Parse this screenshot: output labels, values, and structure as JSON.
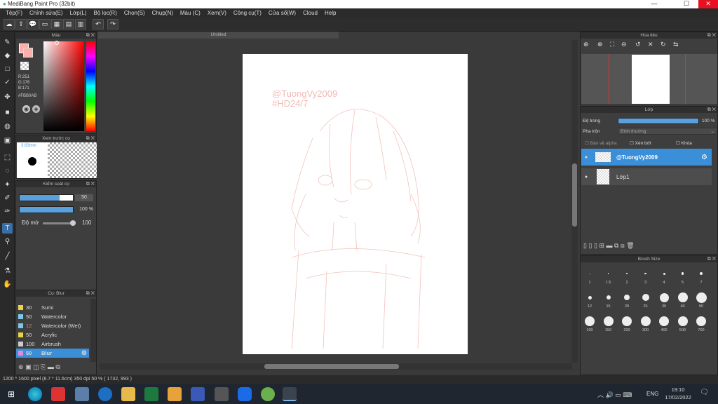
{
  "window": {
    "title": "MediBang Paint Pro (32bit)",
    "min": "—",
    "max": "☐",
    "close": "✕"
  },
  "menu": [
    "Tệp(F)",
    "Chỉnh sửa(E)",
    "Lớp(L)",
    "Bộ lọc(R)",
    "Chọn(S)",
    "Chụp(N)",
    "Màu (C)",
    "Xem(V)",
    "Công cụ(T)",
    "Cửa sổ(W)",
    "Cloud",
    "Help"
  ],
  "color_panel": {
    "title": "Màu",
    "r": "R:251",
    "g": "G:176",
    "b": "B:171",
    "hex": "#FBB0AB",
    "fg": "#fbb0ab"
  },
  "brush_preview": {
    "title": "Xem trước cọ",
    "size": "3.63mm"
  },
  "brush_control": {
    "title": "Kiểm soát cọ",
    "size_value": "50",
    "opacity_value": "100 %",
    "smooth_label": "Độ mờ",
    "smooth_value": "100",
    "size_fill": 0.75,
    "opacity_fill": 1.0,
    "smooth_level": 0.5
  },
  "brush_list": {
    "title": "Cọ: Blur",
    "items": [
      {
        "size": "30",
        "name": "Sumi",
        "color": "#e8d44a"
      },
      {
        "size": "50",
        "name": "Watercolor",
        "color": "#7ec6e8"
      },
      {
        "size": "12",
        "name": "Watercolor (Wet)",
        "color": "#7ec6e8",
        "dim": true
      },
      {
        "size": "50",
        "name": "Acrylic",
        "color": "#e8d44a"
      },
      {
        "size": "100",
        "name": "Airbrush",
        "color": "#cccccc"
      },
      {
        "size": "50",
        "name": "Blur",
        "color": "#e08ad8",
        "selected": true
      }
    ]
  },
  "canvas": {
    "tab": "Untitled",
    "text1": "@TuongVy2009",
    "text2": "#HD24/7"
  },
  "navigator": {
    "title": "Hoa tiêu"
  },
  "layer_panel": {
    "title": "Lớp",
    "opacity_label": "Độ trong",
    "opacity_value": "100 %",
    "opacity_fill": 1.0,
    "blend_label": "Pha trộn",
    "blend_value": "Bình thường",
    "protect_alpha": "Bảo vệ alpha",
    "clipping": "Xén bớt",
    "lock": "Khóa",
    "layers": [
      {
        "name": "@TuongVy2009",
        "selected": true
      },
      {
        "name": "Lớp1",
        "selected": false
      }
    ]
  },
  "brush_size": {
    "title": "Brush Size",
    "rows": [
      [
        "1",
        "1.5",
        "2",
        "3",
        "4",
        "5",
        "7"
      ],
      [
        "12",
        "15",
        "20",
        "25",
        "30",
        "40",
        "50"
      ],
      [
        "100",
        "150",
        "200",
        "300",
        "400",
        "500",
        "700"
      ]
    ]
  },
  "status": "1200 * 1600 pixel  (8.7 * 11.6cm)  350 dpi  50 %  ( 1732, 993 )",
  "taskbar": {
    "lang": "ENG",
    "time": "19:10",
    "date": "17/02/2022"
  }
}
